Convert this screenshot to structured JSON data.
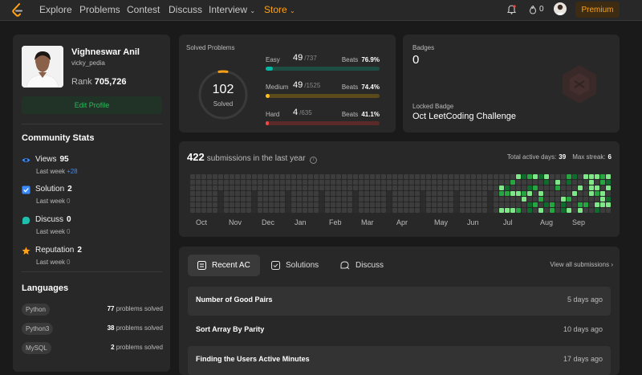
{
  "nav": {
    "items": [
      "Explore",
      "Problems",
      "Contest",
      "Discuss",
      "Interview",
      "Store"
    ],
    "streak": "0",
    "premium": "Premium"
  },
  "profile": {
    "name": "Vighneswar Anil",
    "handle": "vicky_pedia",
    "rank_label": "Rank",
    "rank_value": "705,726",
    "edit_button": "Edit Profile"
  },
  "community": {
    "title": "Community Stats",
    "stats": [
      {
        "label": "Views",
        "value": "95",
        "sub": "Last week",
        "delta": "+28",
        "icon": "eye-icon",
        "color": "#3a8bff"
      },
      {
        "label": "Solution",
        "value": "2",
        "sub": "Last week",
        "delta": "0",
        "icon": "checkbox-icon",
        "color": "#3a8bff"
      },
      {
        "label": "Discuss",
        "value": "0",
        "sub": "Last week",
        "delta": "0",
        "icon": "chat-icon",
        "color": "#1fbfae"
      },
      {
        "label": "Reputation",
        "value": "2",
        "sub": "Last week",
        "delta": "0",
        "icon": "star-icon",
        "color": "#ffa116"
      }
    ]
  },
  "languages": {
    "title": "Languages",
    "items": [
      {
        "name": "Python",
        "count": "77",
        "suffix": "problems solved"
      },
      {
        "name": "Python3",
        "count": "38",
        "suffix": "problems solved"
      },
      {
        "name": "MySQL",
        "count": "2",
        "suffix": "problems solved"
      }
    ]
  },
  "solved": {
    "title": "Solved Problems",
    "total": "102",
    "total_label": "Solved",
    "difficulties": [
      {
        "name": "Easy",
        "solved": "49",
        "total": "/737",
        "beats_label": "Beats",
        "beats": "76.9%",
        "fraction": 0.066,
        "color": "#00b8a3",
        "track": "#1e4d44"
      },
      {
        "name": "Medium",
        "solved": "49",
        "total": "/1525",
        "beats_label": "Beats",
        "beats": "74.4%",
        "fraction": 0.032,
        "color": "#ffc01e",
        "track": "#5a4a1c"
      },
      {
        "name": "Hard",
        "solved": "4",
        "total": "/635",
        "beats_label": "Beats",
        "beats": "41.1%",
        "fraction": 0.006,
        "color": "#ef4743",
        "track": "#5a2a28"
      }
    ]
  },
  "badges": {
    "title": "Badges",
    "count": "0",
    "locked_label": "Locked Badge",
    "locked_name": "Oct LeetCoding Challenge"
  },
  "submissions": {
    "count": "422",
    "text": "submissions in the last year",
    "active_label": "Total active days:",
    "active_value": "39",
    "streak_label": "Max streak:",
    "streak_value": "6",
    "months": [
      "Oct",
      "Nov",
      "Dec",
      "Jan",
      "Feb",
      "Mar",
      "Apr",
      "May",
      "Jun",
      "Jul",
      "Aug",
      "Sep"
    ]
  },
  "recent": {
    "tabs": [
      "Recent AC",
      "Solutions",
      "Discuss"
    ],
    "view_all": "View all submissions",
    "rows": [
      {
        "title": "Number of Good Pairs",
        "time": "5 days ago"
      },
      {
        "title": "Sort Array By Parity",
        "time": "10 days ago"
      },
      {
        "title": "Finding the Users Active Minutes",
        "time": "17 days ago"
      }
    ]
  }
}
